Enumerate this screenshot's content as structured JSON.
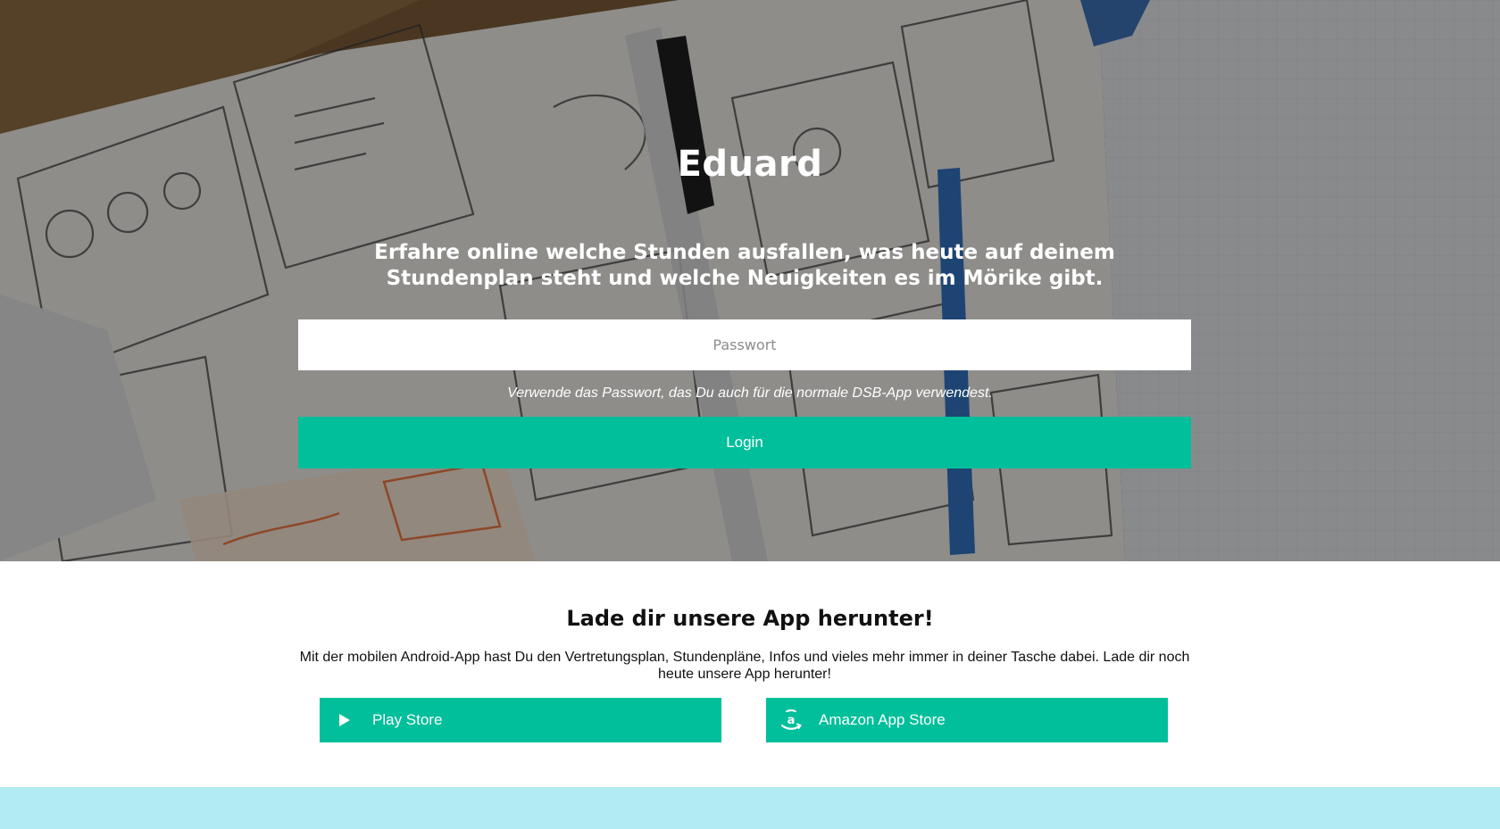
{
  "hero": {
    "title": "Eduard",
    "tagline": "Erfahre online welche Stunden ausfallen, was heute auf deinem Stundenplan steht und welche Neuigkeiten es im Mörike gibt.",
    "password_placeholder": "Passwort",
    "password_value": "",
    "hint": "Verwende das Passwort, das Du auch für die normale DSB-App verwendest.",
    "login_label": "Login"
  },
  "app_section": {
    "title": "Lade dir unsere App herunter!",
    "text": "Mit der mobilen Android-App hast Du den Vertretungsplan, Stundenpläne, Infos und vieles mehr immer in deiner Tasche dabei. Lade dir noch heute unsere App herunter!",
    "buttons": [
      {
        "label": "Play Store",
        "icon": "play-icon"
      },
      {
        "label": "Amazon App Store",
        "icon": "amazon-icon"
      }
    ]
  },
  "colors": {
    "accent": "#00bf9a",
    "footer": "#b2ebf2",
    "text_dark": "#111111"
  }
}
